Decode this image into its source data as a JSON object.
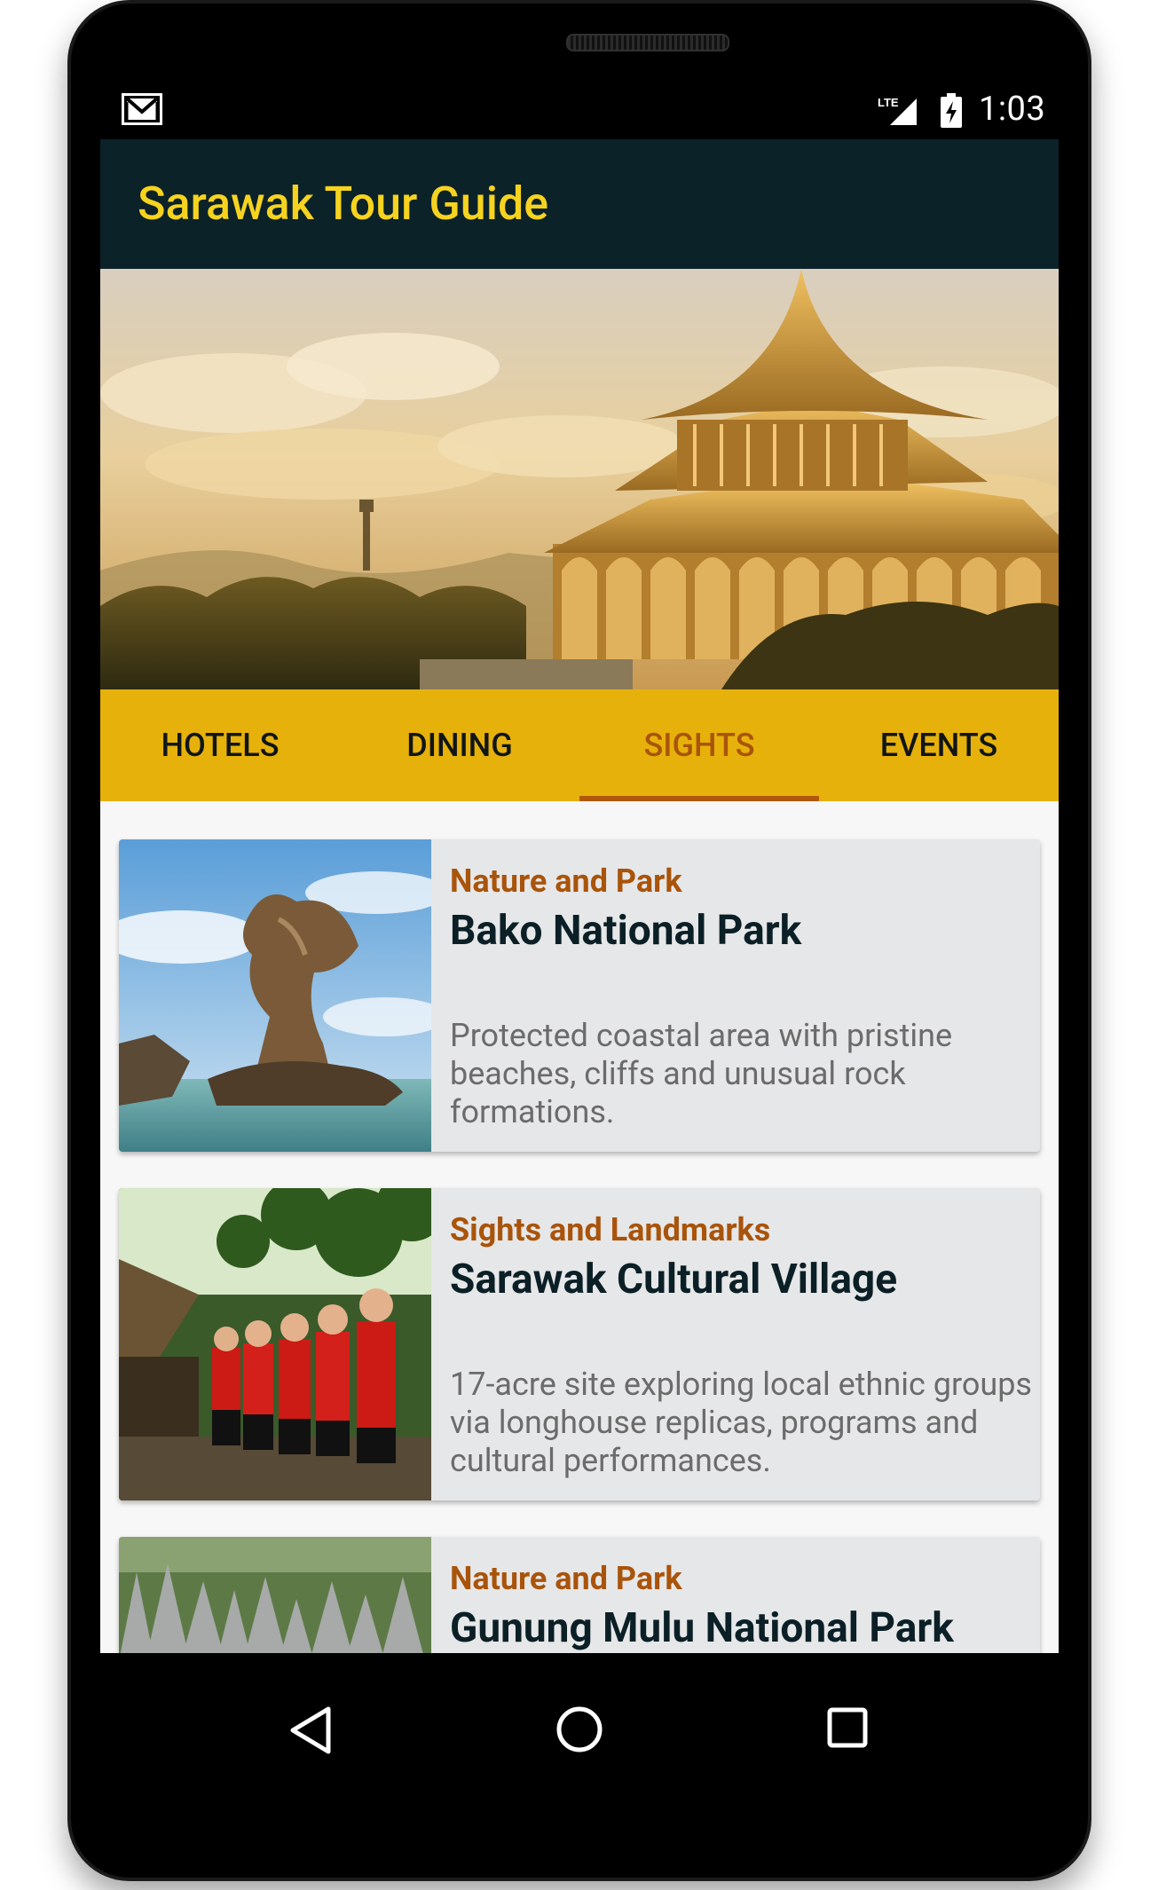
{
  "status_bar": {
    "time": "1:03",
    "network": "LTE",
    "notification_icon": "gmail-icon",
    "battery_icon": "battery-charging-icon"
  },
  "app_bar": {
    "title": "Sarawak Tour Guide"
  },
  "hero": {
    "image": "sarawak-state-legislative-assembly-building"
  },
  "tabs": [
    {
      "label": "HOTELS",
      "active": false
    },
    {
      "label": "DINING",
      "active": false
    },
    {
      "label": "SIGHTS",
      "active": true
    },
    {
      "label": "EVENTS",
      "active": false
    }
  ],
  "cards": [
    {
      "category": "Nature and Park",
      "title": "Bako National Park",
      "description": "Protected coastal area with pristine beaches, cliffs and unusual rock formations.",
      "image": "sea-stack-rock-photo"
    },
    {
      "category": "Sights and Landmarks",
      "title": "Sarawak Cultural Village",
      "description": "17-acre site exploring local ethnic groups via longhouse replicas, programs and cultural performances.",
      "image": "cultural-dancers-photo"
    },
    {
      "category": "Nature and Park",
      "title": "Gunung Mulu National Park",
      "description": "",
      "image": "limestone-pinnacles-photo"
    }
  ],
  "nav_bar": {
    "back_icon": "back-triangle-icon",
    "home_icon": "home-circle-icon",
    "recents_icon": "recents-square-icon"
  },
  "colors": {
    "app_bar_bg": "#0c2229",
    "title_yellow": "#f6d31f",
    "tab_bar_bg": "#e7b10b",
    "active_tab": "#a9540b",
    "card_bg": "#e6e7e8",
    "card_title": "#0b1f26",
    "card_desc": "#6b6b6b"
  }
}
